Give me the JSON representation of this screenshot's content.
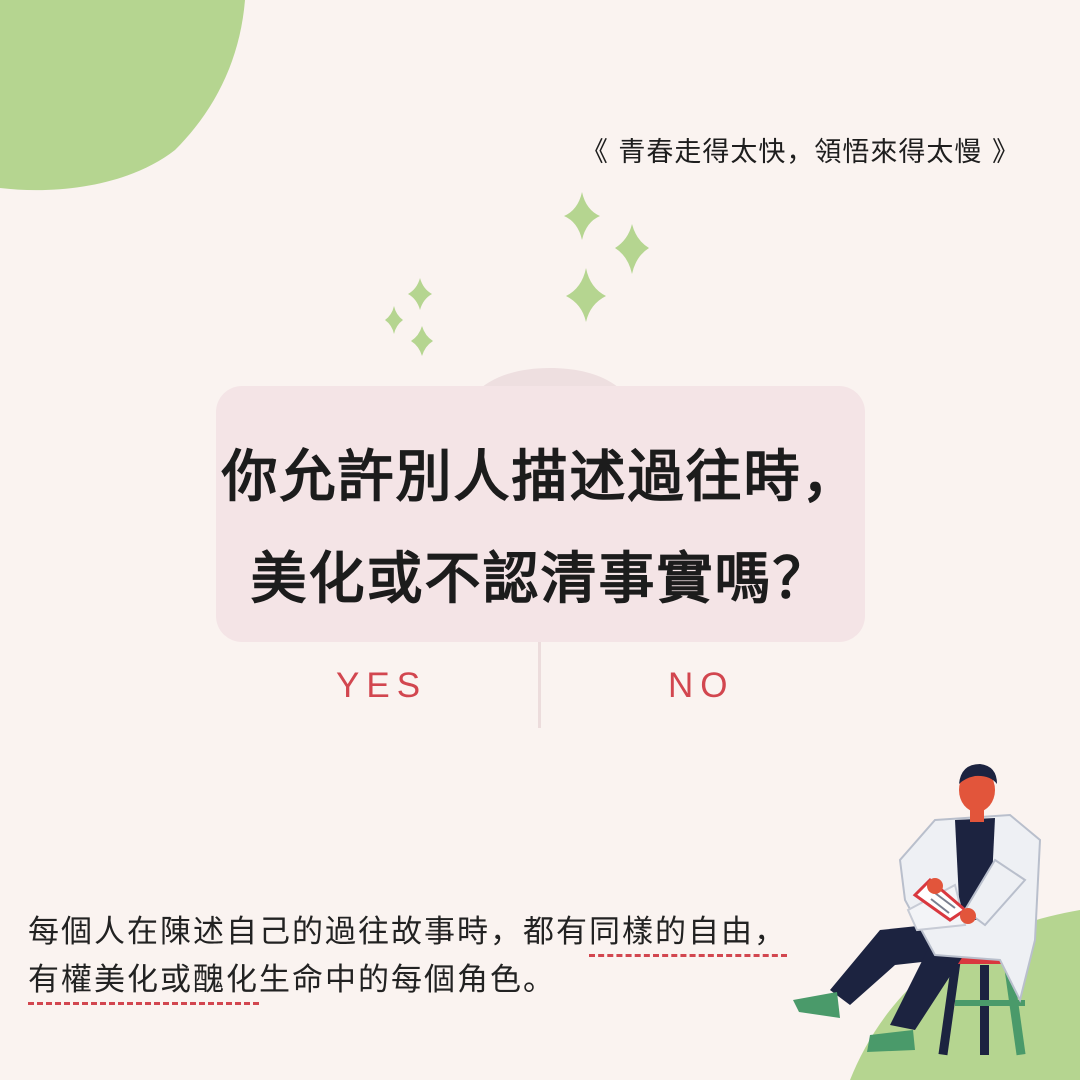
{
  "subtitle": "《 青春走得太快，領悟來得太慢 》",
  "question": {
    "line1": "你允許別人描述過往時，",
    "line2": "美化或不認清事實嗎？"
  },
  "options": {
    "yes": "YES",
    "no": "NO"
  },
  "body": {
    "line1_a": "每個人在陳述自己的過往故事時，都有",
    "line1_u": "同樣的自由，",
    "line2_u": "有權美化或醜化",
    "line2_b": "生命中的每個角色。"
  },
  "colors": {
    "background": "#faf3f0",
    "green": "#b5d590",
    "card": "#f4e4e6",
    "accent_red": "#d2464f",
    "text": "#1c1c1c"
  },
  "icons": [
    "sparkle-icon",
    "person-illustration"
  ]
}
